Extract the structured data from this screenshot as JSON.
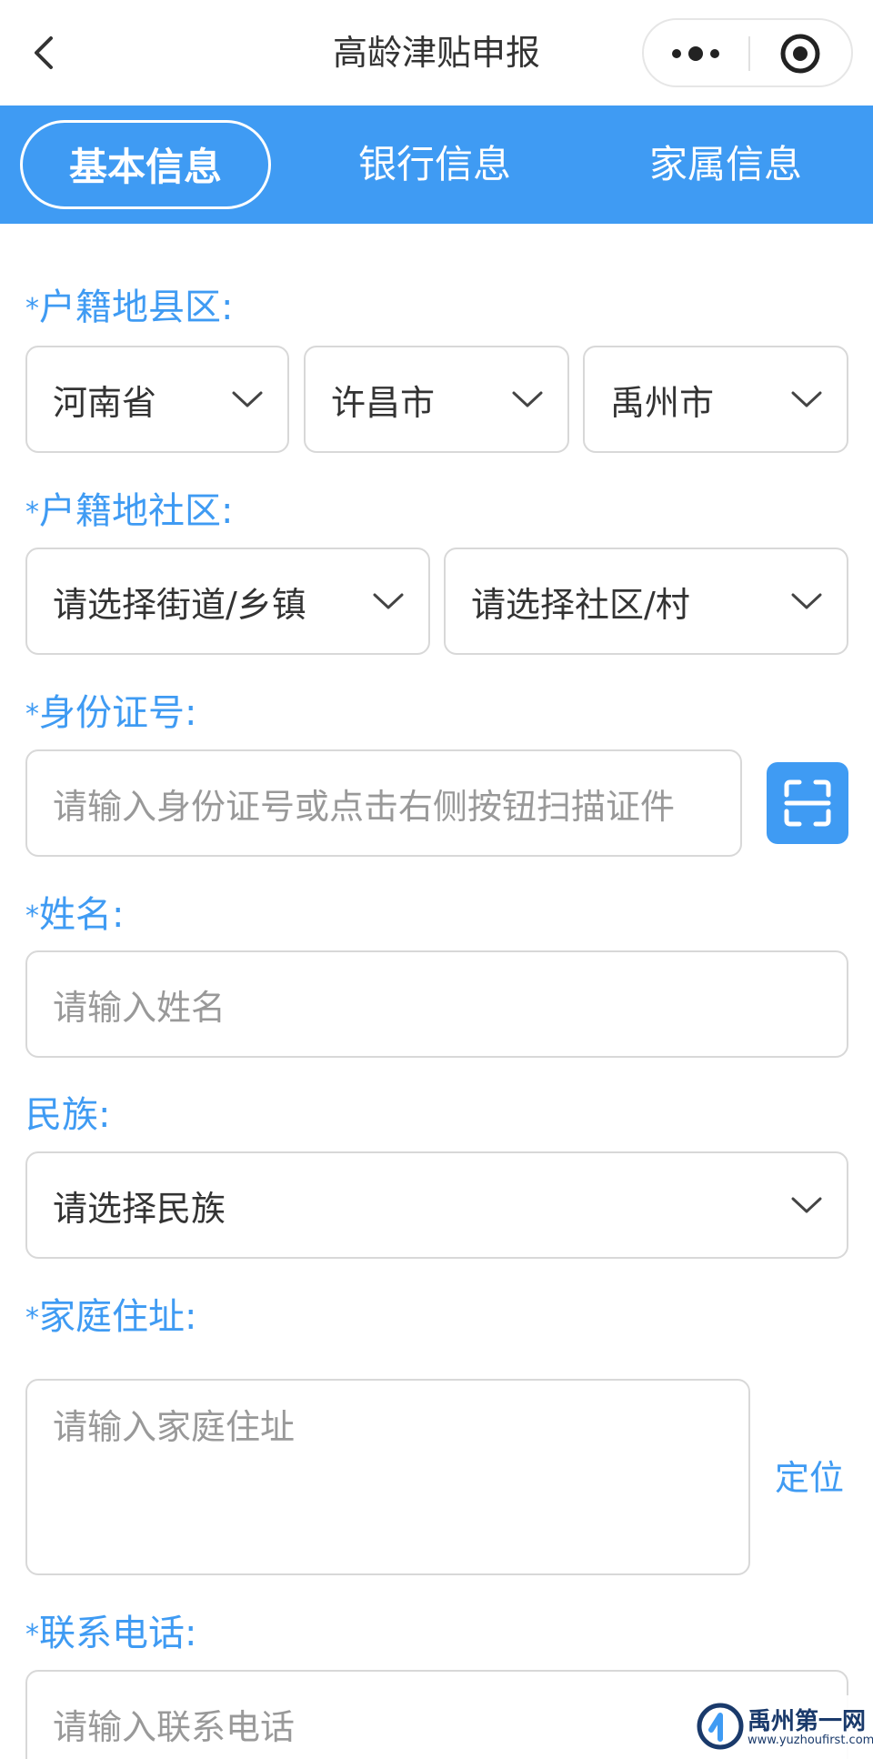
{
  "navbar": {
    "title": "高龄津贴申报",
    "back_icon": "chevron-left-icon",
    "more_icon": "more-dots-icon",
    "close_icon": "target-close-icon"
  },
  "tabs": [
    {
      "label": "基本信息",
      "active": true
    },
    {
      "label": "银行信息",
      "active": false
    },
    {
      "label": "家属信息",
      "active": false
    }
  ],
  "form": {
    "required_mark": "*",
    "hukou_county": {
      "label": "户籍地县区:",
      "province": "河南省",
      "city": "许昌市",
      "county": "禹州市"
    },
    "hukou_community": {
      "label": "户籍地社区:",
      "street_placeholder": "请选择街道/乡镇",
      "community_placeholder": "请选择社区/村"
    },
    "id_number": {
      "label": "身份证号:",
      "placeholder": "请输入身份证号或点击右侧按钮扫描证件",
      "scan_icon": "scan-icon"
    },
    "name": {
      "label": "姓名:",
      "placeholder": "请输入姓名"
    },
    "ethnicity": {
      "label": "民族:",
      "placeholder": "请选择民族"
    },
    "address": {
      "label": "家庭住址:",
      "placeholder": "请输入家庭住址",
      "locate_label": "定位"
    },
    "phone": {
      "label": "联系电话:",
      "placeholder": "请输入联系电话"
    }
  },
  "watermark": {
    "name": "禹州第一网",
    "url": "www.yuzhoufirst.com"
  },
  "colors": {
    "accent": "#3f9bf3",
    "border": "#d8d8d8",
    "placeholder": "#999999"
  }
}
